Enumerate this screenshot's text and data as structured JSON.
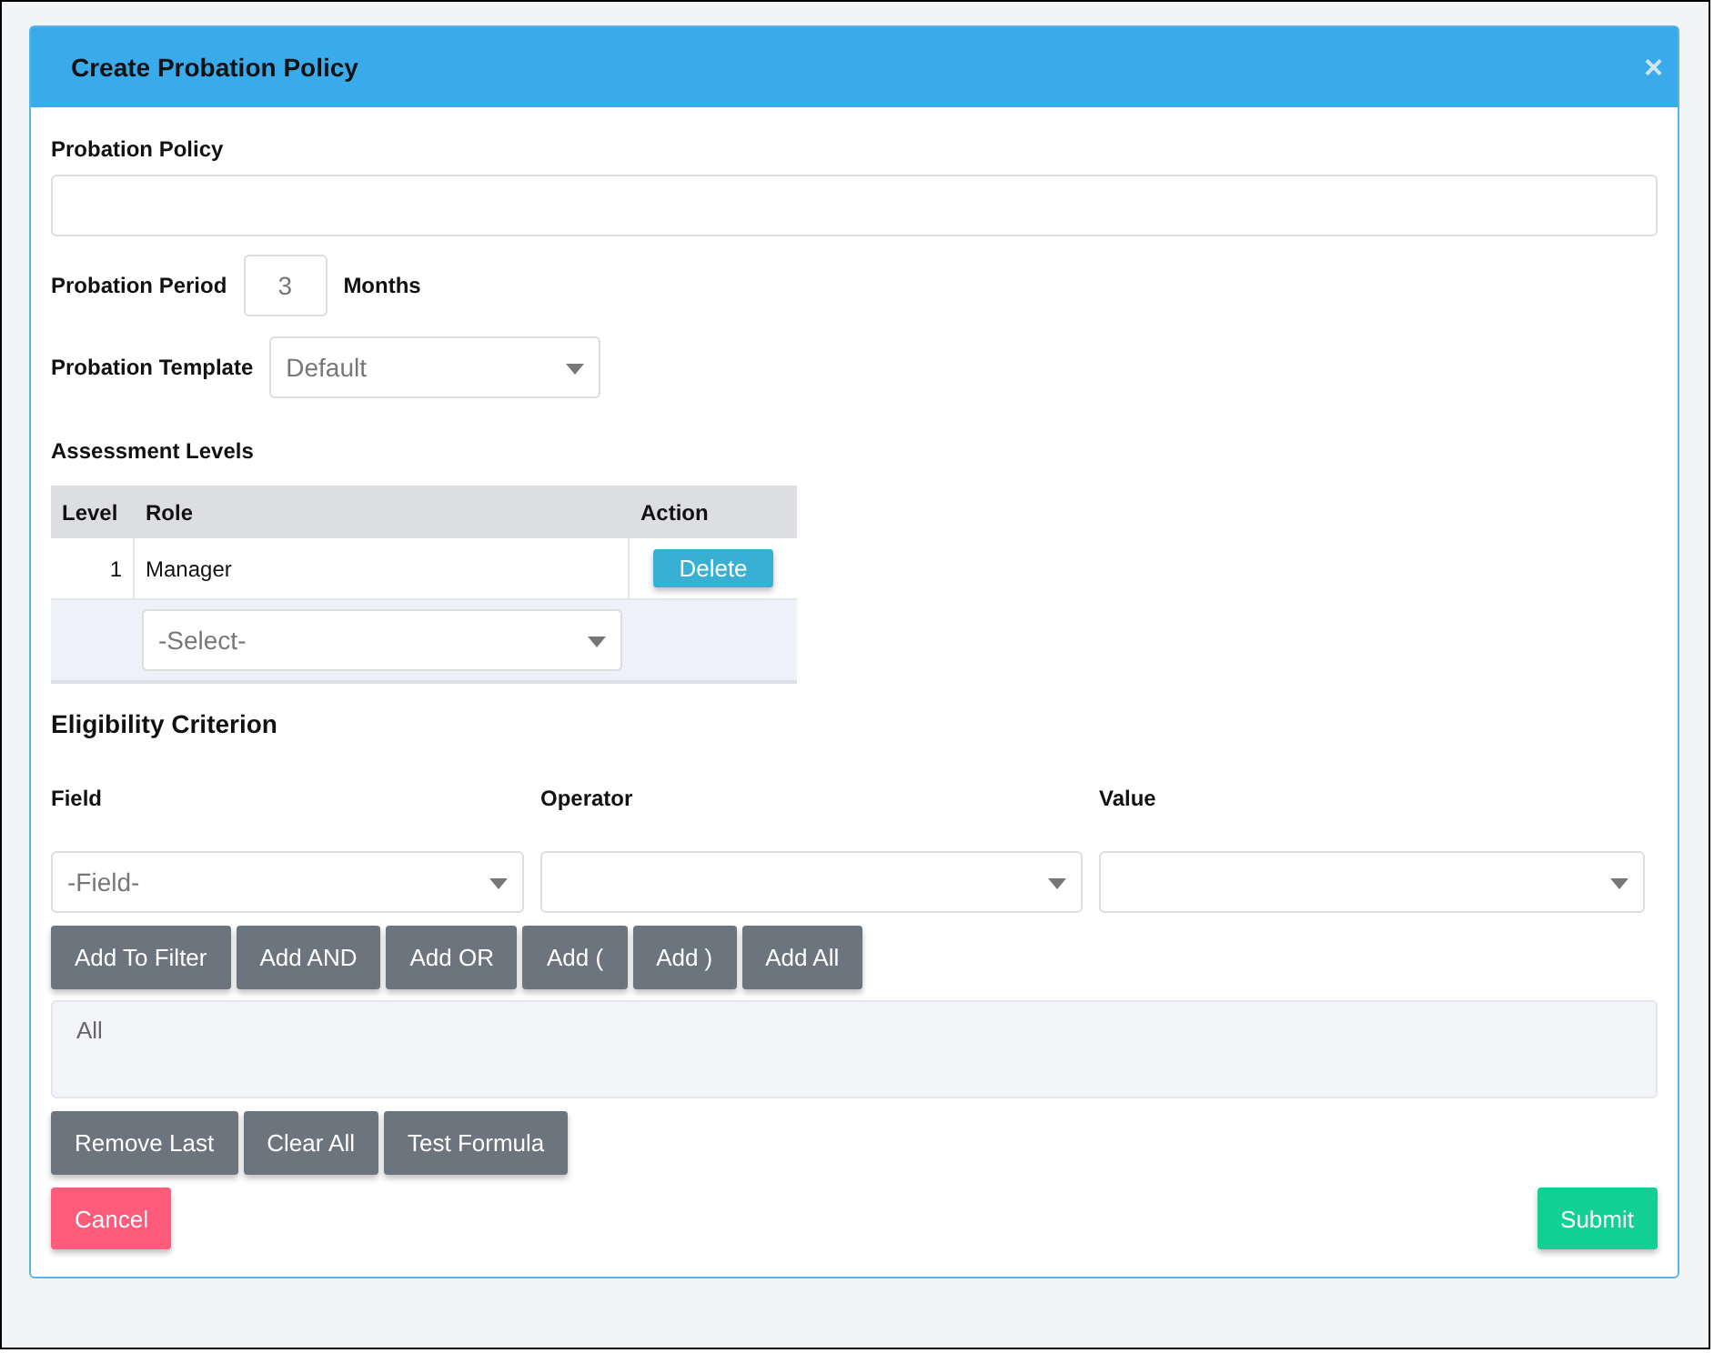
{
  "dialog": {
    "title": "Create Probation Policy",
    "close": "×"
  },
  "policy": {
    "label": "Probation Policy"
  },
  "period": {
    "label": "Probation Period",
    "value": "3",
    "unit": "Months"
  },
  "template": {
    "label": "Probation Template",
    "value": "Default"
  },
  "assessment": {
    "title": "Assessment Levels",
    "columns": [
      "Level",
      "Role",
      "Action"
    ],
    "rows": [
      {
        "level": "1",
        "role": "Manager",
        "action": "Delete"
      }
    ],
    "new_row": {
      "placeholder": "-Select-"
    }
  },
  "eligibility": {
    "title": "Eligibility Criterion",
    "fields": [
      {
        "label": "Field",
        "value": "-Field-"
      },
      {
        "label": "Operator"
      },
      {
        "label": "Value"
      }
    ],
    "filter_buttons": [
      "Add To Filter",
      "Add AND",
      "Add OR",
      "Add (",
      "Add )",
      "Add All"
    ],
    "formula": "All",
    "formula_buttons": [
      "Remove Last",
      "Clear All",
      "Test Formula"
    ]
  },
  "footer": [
    {
      "label": "Cancel",
      "kind": "cancel"
    },
    {
      "label": "Submit",
      "kind": "submit"
    }
  ]
}
